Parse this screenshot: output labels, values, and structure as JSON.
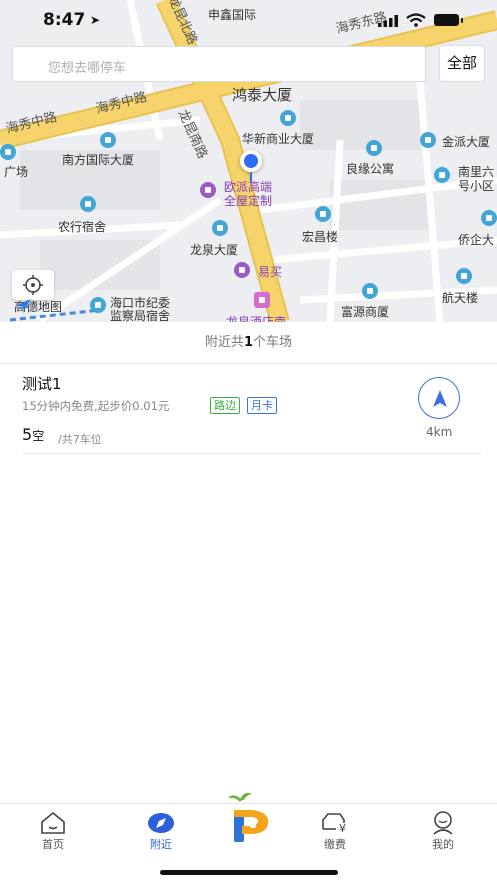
{
  "status_bar": {
    "time": "8:47"
  },
  "search": {
    "placeholder": "您想去哪停车",
    "all_label": "全部"
  },
  "map": {
    "labels": {
      "shenxin": "申鑫国际",
      "haixiu_east": "海秀东路",
      "hongtai": "鸿泰大厦",
      "haixiu_middle_a": "海秀中路",
      "haixiu_middle_b": "海秀中路",
      "longkun": "龙昆南路",
      "longkun_north": "龙昆北路",
      "huaxin": "华新商业大厦",
      "jinpai": "金派大厦",
      "nanfang": "南方国际大厦",
      "liangyuan": "良缘公寓",
      "nanli": "南里六",
      "nanli2": "号小区",
      "guangchang": "广场",
      "oupai1": "欧派高端",
      "oupai2": "全屋定制",
      "nonghang": "农行宿舍",
      "hongchang": "宏昌楼",
      "qiaoqi": "侨企大",
      "longquan": "龙泉大厦",
      "yimai": "易买",
      "hangtian": "航天楼",
      "haikou1": "海口市纪委",
      "haikou2": "监察局宿舍",
      "fuyuan": "富源商厦",
      "longquan_hotel": "龙泉酒店南",
      "amap": "高德地图"
    }
  },
  "summary": {
    "prefix": "附近共",
    "count": "1",
    "suffix": "个车场"
  },
  "lots": [
    {
      "name": "测试1",
      "desc": "15分钟内免费,起步价0.01元",
      "tags": [
        "路边",
        "月卡"
      ],
      "free": "5",
      "free_unit": "空",
      "total": "/共7车位",
      "distance": "4km"
    }
  ],
  "tabbar": {
    "items": [
      {
        "label": "首页",
        "icon": "home-icon"
      },
      {
        "label": "附近",
        "icon": "compass-icon"
      },
      {
        "label": "",
        "icon": "parking-logo-icon"
      },
      {
        "label": "缴费",
        "icon": "car-payment-icon"
      },
      {
        "label": "我的",
        "icon": "user-icon"
      }
    ]
  },
  "colors": {
    "accent": "#2d5fd8",
    "road_yellow": "#f6d36b",
    "tag_green": "#3ab03e",
    "tag_blue": "#3d6fe0"
  }
}
